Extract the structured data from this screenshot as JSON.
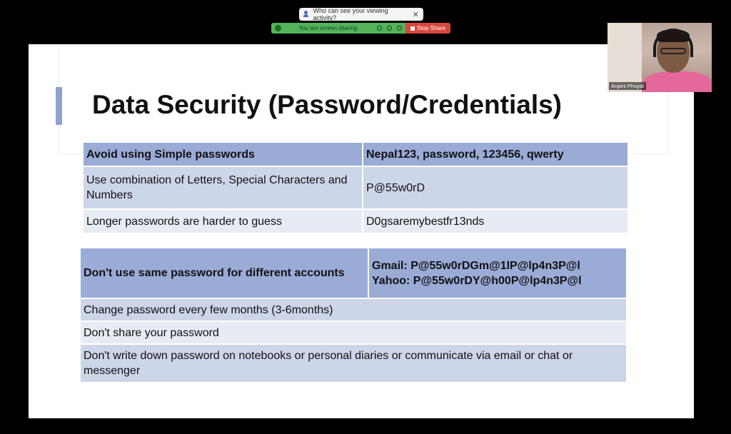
{
  "share_banner": {
    "viewing_activity_text": "Who can see your viewing activity?",
    "close_glyph": "✕",
    "sharing_status": "You are screen sharing",
    "stop_share_label": "Stop Share",
    "colors": {
      "sharing": "#52b35a",
      "stop": "#d8473c"
    }
  },
  "slide": {
    "title": "Data Security (Password/Credentials)",
    "accent_color": "#8ea2cf",
    "table1": {
      "header": [
        "Avoid using Simple passwords",
        "Nepal123, password, 123456, qwerty"
      ],
      "rows": [
        [
          "Use combination of Letters, Special Characters and Numbers",
          "P@55w0rD"
        ],
        [
          "Longer passwords are harder to guess",
          "D0gsaremybestfr13nds"
        ]
      ]
    },
    "table2": {
      "header": {
        "left": "Don't use same password for different accounts",
        "right_line1": "Gmail: P@55w0rDGm@1lP@lp4n3P@l",
        "right_line2": "Yahoo: P@55w0rDY@h00P@lp4n3P@l"
      },
      "rows": [
        "Change password every few months (3-6months)",
        "Don't share your password",
        "Don't write down password on notebooks or personal diaries or communicate via email or chat or messenger"
      ]
    }
  },
  "webcam": {
    "participant_name": "Anjani Phuyal"
  }
}
